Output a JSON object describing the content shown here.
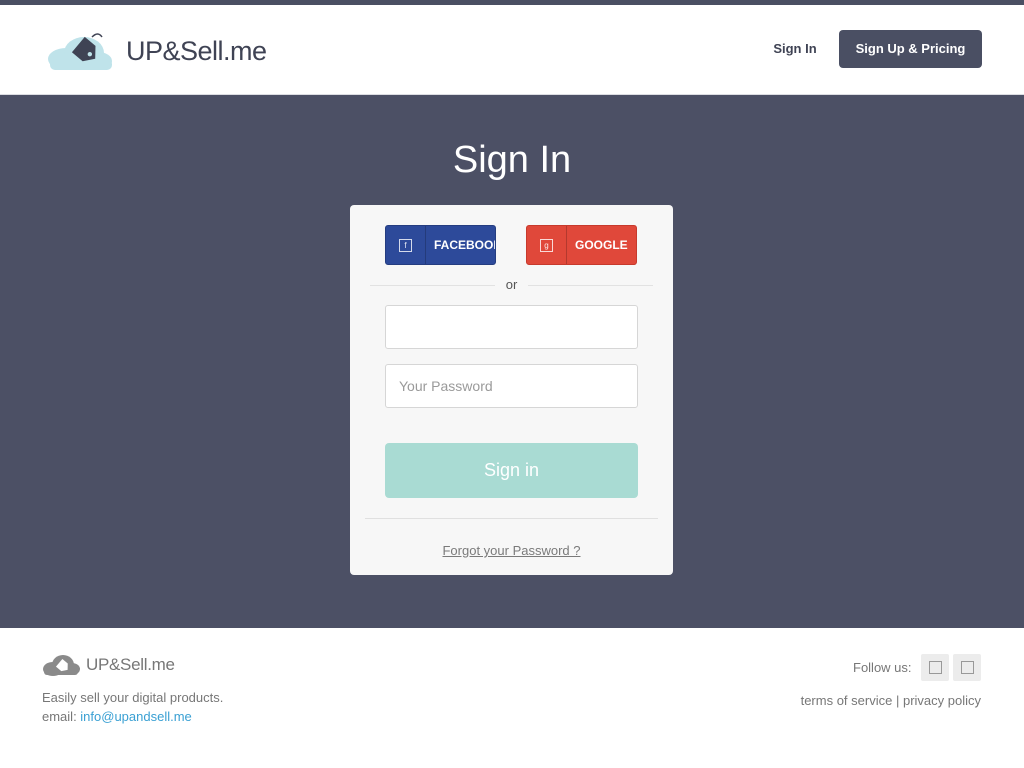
{
  "header": {
    "logo_text": "UP&Sell.me",
    "nav_signin": "Sign In",
    "nav_signup": "Sign Up & Pricing"
  },
  "hero": {
    "title": "Sign In"
  },
  "form": {
    "facebook_label": "FACEBOOK",
    "google_label": "GOOGLE",
    "or_text": "or",
    "email_value": "",
    "email_placeholder": "",
    "password_placeholder": "Your Password",
    "submit_label": "Sign in",
    "forgot_label": "Forgot your Password ?"
  },
  "footer": {
    "logo_text": "UP&Sell.me",
    "tagline": "Easily sell your digital products.",
    "email_prefix": "email: ",
    "email": "info@upandsell.me",
    "follow_label": "Follow us:",
    "terms": "terms of service",
    "separator": "|",
    "privacy": "privacy policy"
  },
  "icons": {
    "logo": "price-tag-cloud-icon",
    "facebook": "facebook-icon",
    "google": "google-icon",
    "social_1": "social-icon",
    "social_2": "social-icon"
  },
  "colors": {
    "header_strip": "#4a4f63",
    "hero_bg": "#4c5065",
    "facebook": "#2d4a9a",
    "google": "#e0483a",
    "submit": "#a9dbd3",
    "link": "#3aa0d3"
  }
}
